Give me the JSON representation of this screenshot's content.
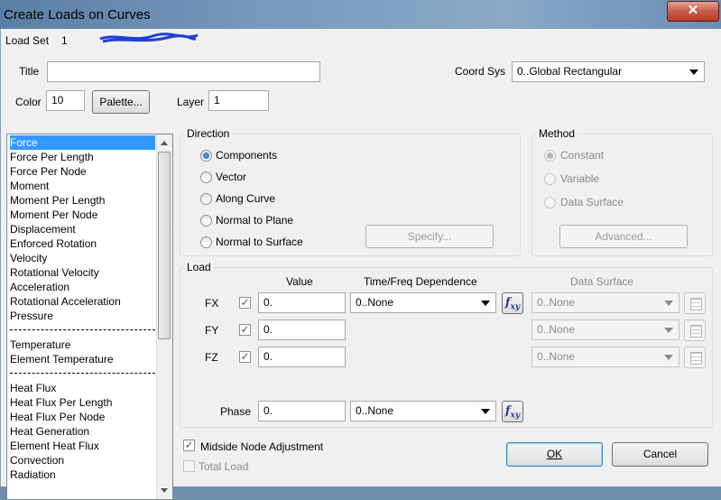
{
  "window": {
    "title": "Create Loads on Curves",
    "close_glyph": "✕"
  },
  "header": {
    "load_set_label": "Load Set",
    "load_set_value": "1"
  },
  "general": {
    "title_label": "Title",
    "title_value": "",
    "coord_sys_label": "Coord Sys",
    "coord_sys_value": "0..Global Rectangular",
    "color_label": "Color",
    "color_value": "10",
    "palette_button": "Palette...",
    "layer_label": "Layer",
    "layer_value": "1"
  },
  "load_types": {
    "selected": "Force",
    "group1": [
      "Force",
      "Force Per Length",
      "Force Per Node",
      "Moment",
      "Moment Per Length",
      "Moment Per Node",
      "Displacement",
      "Enforced Rotation",
      "Velocity",
      "Rotational Velocity",
      "Acceleration",
      "Rotational Acceleration",
      "Pressure"
    ],
    "group2": [
      "Temperature",
      "Element Temperature"
    ],
    "group3": [
      "Heat Flux",
      "Heat Flux Per Length",
      "Heat Flux Per Node",
      "Heat Generation",
      "Element Heat Flux",
      "Convection",
      "Radiation"
    ]
  },
  "direction": {
    "title": "Direction",
    "options": [
      "Components",
      "Vector",
      "Along Curve",
      "Normal to Plane",
      "Normal to Surface"
    ],
    "selected": "Components",
    "specify_button": "Specify..."
  },
  "method": {
    "title": "Method",
    "options": [
      "Constant",
      "Variable",
      "Data Surface"
    ],
    "selected": "Constant",
    "advanced_button": "Advanced..."
  },
  "load": {
    "title": "Load",
    "col_value": "Value",
    "col_time_freq": "Time/Freq Dependence",
    "col_data_surface": "Data Surface",
    "rows": [
      {
        "label": "FX",
        "checked": true,
        "value": "0.",
        "dependence": "0..None",
        "data_surface": "0..None"
      },
      {
        "label": "FY",
        "checked": true,
        "value": "0.",
        "data_surface": "0..None"
      },
      {
        "label": "FZ",
        "checked": true,
        "value": "0.",
        "data_surface": "0..None"
      }
    ],
    "phase_label": "Phase",
    "phase_value": "0.",
    "phase_dependence": "0..None",
    "fxy_label": "f",
    "fxy_sub": "xy"
  },
  "options": {
    "midside_label": "Midside Node Adjustment",
    "midside_checked": true,
    "total_load_label": "Total Load",
    "total_load_checked": false
  },
  "buttons": {
    "ok": "OK",
    "cancel": "Cancel"
  },
  "colors": {
    "selection": "#3399ff",
    "title_bar": "#6e8fae",
    "close_button": "#c75d47"
  }
}
